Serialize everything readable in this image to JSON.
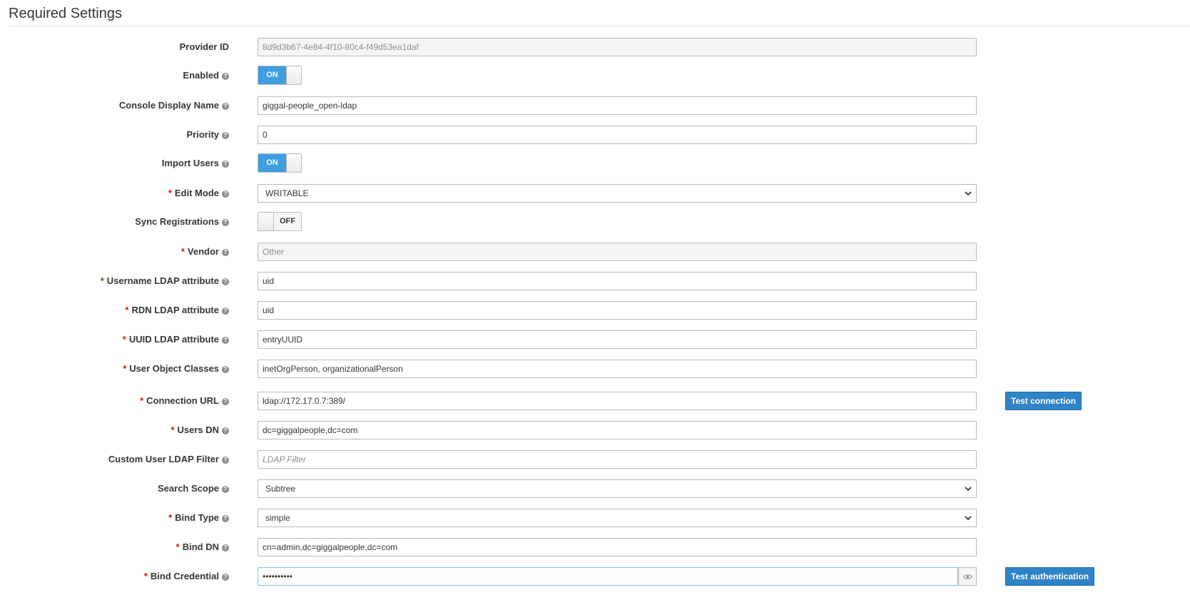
{
  "section": {
    "title": "Required Settings"
  },
  "fields": {
    "provider_id": {
      "label": "Provider ID",
      "value": "8d9d3b67-4e84-4f10-80c4-f49d53ea1daf"
    },
    "enabled": {
      "label": "Enabled",
      "state": "ON"
    },
    "console_display_name": {
      "label": "Console Display Name",
      "value": "giggal-people_open-ldap"
    },
    "priority": {
      "label": "Priority",
      "value": "0"
    },
    "import_users": {
      "label": "Import Users",
      "state": "ON"
    },
    "edit_mode": {
      "label": "Edit Mode",
      "value": "WRITABLE"
    },
    "sync_registrations": {
      "label": "Sync Registrations",
      "state": "OFF"
    },
    "vendor": {
      "label": "Vendor",
      "value": "Other"
    },
    "username_ldap_attribute": {
      "label": "Username LDAP attribute",
      "value": "uid"
    },
    "rdn_ldap_attribute": {
      "label": "RDN LDAP attribute",
      "value": "uid"
    },
    "uuid_ldap_attribute": {
      "label": "UUID LDAP attribute",
      "value": "entryUUID"
    },
    "user_object_classes": {
      "label": "User Object Classes",
      "value": "inetOrgPerson, organizationalPerson"
    },
    "connection_url": {
      "label": "Connection URL",
      "value": "ldap://172.17.0.7:389/"
    },
    "users_dn": {
      "label": "Users DN",
      "value": "dc=giggalpeople,dc=com"
    },
    "custom_user_ldap_filter": {
      "label": "Custom User LDAP Filter",
      "value": "",
      "placeholder": "LDAP Filter"
    },
    "search_scope": {
      "label": "Search Scope",
      "value": "Subtree"
    },
    "bind_type": {
      "label": "Bind Type",
      "value": "simple"
    },
    "bind_dn": {
      "label": "Bind DN",
      "value": "cn=admin,dc=giggalpeople,dc=com"
    },
    "bind_credential": {
      "label": "Bind Credential",
      "value": "••••••••••"
    }
  },
  "buttons": {
    "test_connection": "Test connection",
    "test_authentication": "Test authentication"
  },
  "icons": {
    "help": "question-circle-icon",
    "required": "asterisk",
    "reveal": "eye-icon",
    "select": "chevron-down-icon"
  },
  "colors": {
    "primary": "#2f83c7",
    "toggle_on": "#3f9ee0",
    "required": "#c9190b"
  }
}
